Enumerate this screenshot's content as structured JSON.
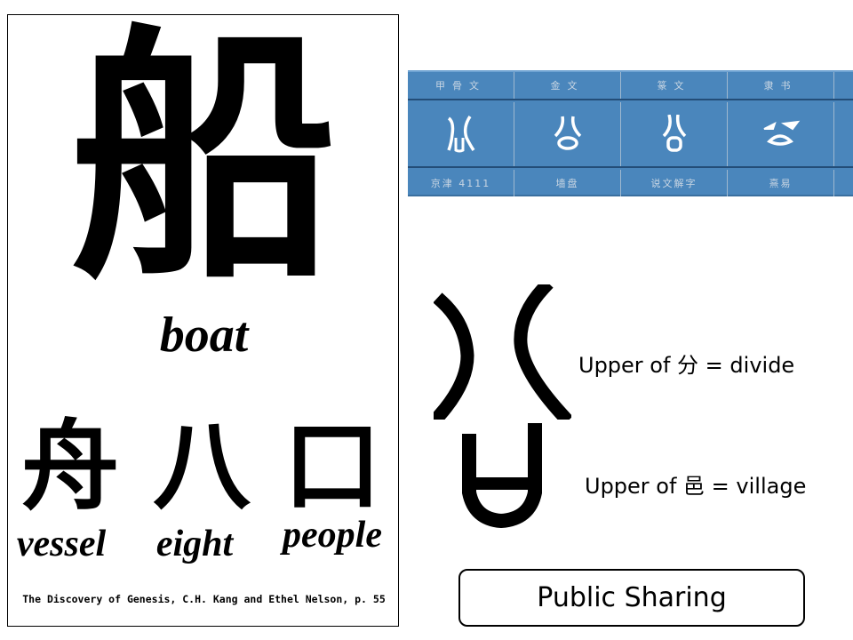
{
  "book_page": {
    "main_character": "船",
    "main_meaning": "boat",
    "components": [
      {
        "character": "舟",
        "meaning": "vessel"
      },
      {
        "character": "八",
        "meaning": "eight"
      },
      {
        "character": "口",
        "meaning": "people"
      }
    ],
    "citation": "The Discovery of Genesis, C.H. Kang and Ethel Nelson, p. 55"
  },
  "script_table": {
    "colors": {
      "background": "#4a86bc",
      "text": "#c9d6e3",
      "divider": "#234d78"
    },
    "headers": [
      "甲骨文",
      "金文",
      "篆文",
      "隶书"
    ],
    "glyphs": [
      "oracle-bone-glyph",
      "bronze-glyph",
      "seal-glyph",
      "clerical-glyph"
    ],
    "sources": [
      "京津 4111",
      "墙盘",
      "说文解字",
      "熹易"
    ]
  },
  "annotations": [
    {
      "text": "Upper of 分 = divide"
    },
    {
      "text": "Upper of 邑 = village"
    }
  ],
  "button": {
    "label": "Public Sharing"
  }
}
